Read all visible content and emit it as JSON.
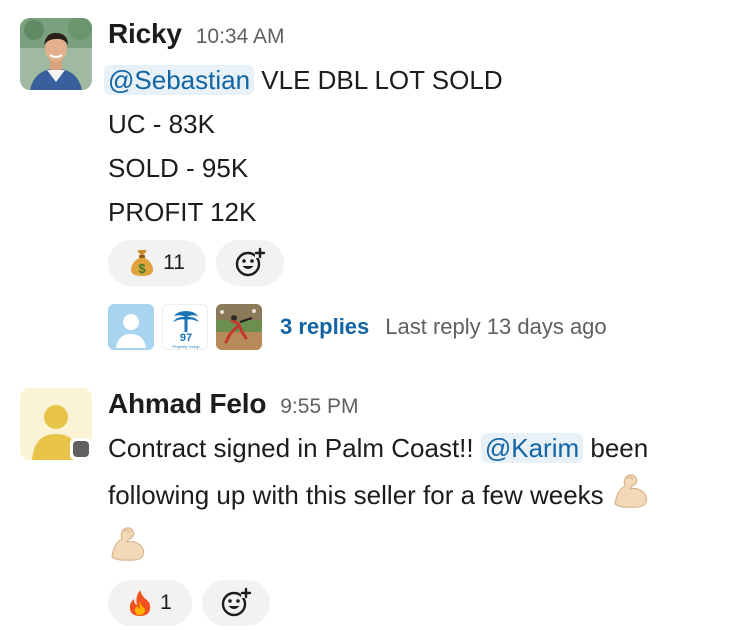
{
  "messages": [
    {
      "author": "Ricky",
      "time": "10:34 AM",
      "mention": "@Sebastian",
      "line1_rest": " VLE DBL LOT SOLD",
      "line2": "UC - 83K",
      "line3": "SOLD - 95K",
      "line4": "PROFIT 12K",
      "reaction": {
        "emoji": "money-bag-icon",
        "count": "11"
      },
      "thread": {
        "replies": "3 replies",
        "last_reply": "Last reply 13 days ago",
        "avatar2_text": "97",
        "avatar2_subtext": "Property Group"
      }
    },
    {
      "author": "Ahmad Felo",
      "time": "9:55 PM",
      "text_before": "Contract signed in Palm Coast!! ",
      "mention": "@Karim",
      "text_after": " been",
      "line2": "following up with this seller for a few weeks ",
      "reaction": {
        "emoji": "fire-icon",
        "count": "1"
      }
    }
  ],
  "colors": {
    "link": "#1264a3",
    "mention_bg": "#e8f1f8",
    "reaction_bg": "#f2f2f2",
    "timestamp": "#616061"
  }
}
